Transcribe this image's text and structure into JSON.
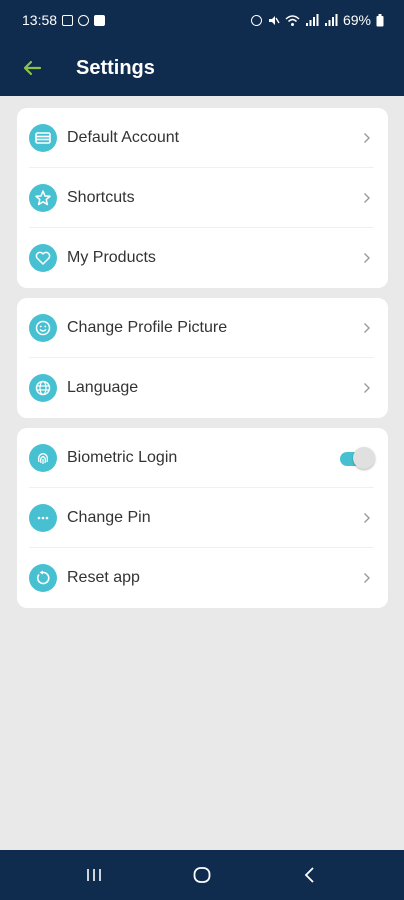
{
  "status_bar": {
    "time": "13:58",
    "battery": "69%"
  },
  "app_bar": {
    "title": "Settings",
    "back_icon": "arrow-left-icon"
  },
  "colors": {
    "header": "#0f2b4e",
    "accent": "#47c1d1",
    "back_arrow": "#8bc34a",
    "background": "#e9e9e9"
  },
  "groups": [
    {
      "items": [
        {
          "label": "Default Account",
          "icon": "card-icon"
        },
        {
          "label": "Shortcuts",
          "icon": "star-icon"
        },
        {
          "label": "My Products",
          "icon": "heart-icon"
        }
      ]
    },
    {
      "items": [
        {
          "label": "Change Profile Picture",
          "icon": "smiley-icon"
        },
        {
          "label": "Language",
          "icon": "globe-icon"
        }
      ]
    },
    {
      "items": [
        {
          "label": "Biometric Login",
          "icon": "fingerprint-icon",
          "toggle": true
        },
        {
          "label": "Change Pin",
          "icon": "dots-icon"
        },
        {
          "label": "Reset app",
          "icon": "reset-icon"
        }
      ]
    }
  ]
}
